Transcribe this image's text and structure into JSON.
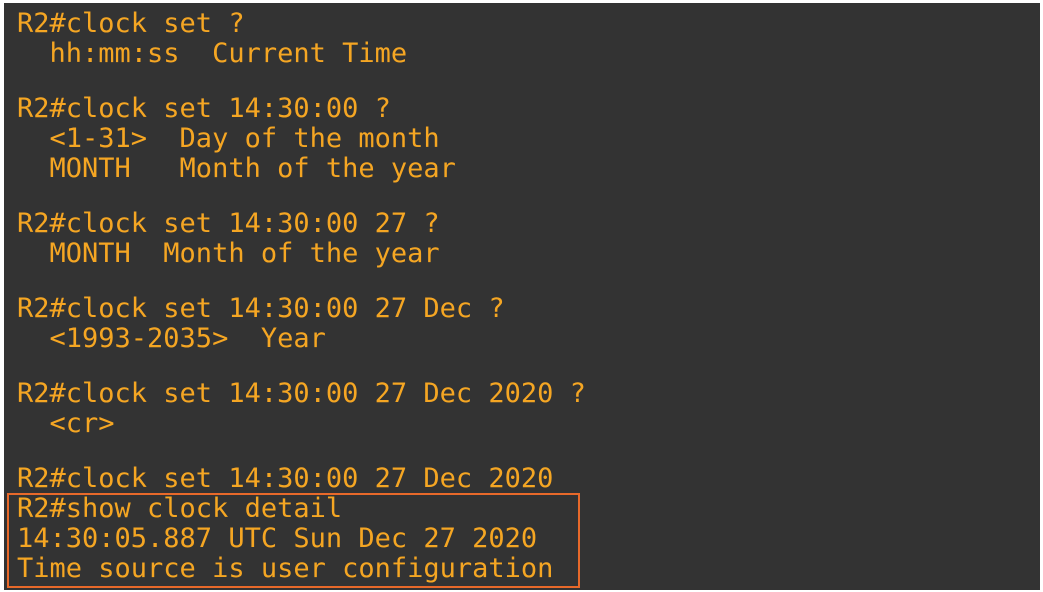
{
  "terminal": {
    "colors": {
      "background": "#333333",
      "text": "#f5a623",
      "highlight_border": "#e8692a"
    },
    "lines": [
      "R2#clock set ?",
      "  hh:mm:ss  Current Time",
      "R2#clock set 14:30:00 ?",
      "  <1-31>  Day of the month",
      "  MONTH   Month of the year",
      "R2#clock set 14:30:00 27 ?",
      "  MONTH  Month of the year",
      "R2#clock set 14:30:00 27 Dec ?",
      "  <1993-2035>  Year",
      "R2#clock set 14:30:00 27 Dec 2020 ?",
      "  <cr>",
      "R2#clock set 14:30:00 27 Dec 2020",
      "R2#show clock detail",
      "14:30:05.887 UTC Sun Dec 27 2020",
      "Time source is user configuration"
    ]
  }
}
